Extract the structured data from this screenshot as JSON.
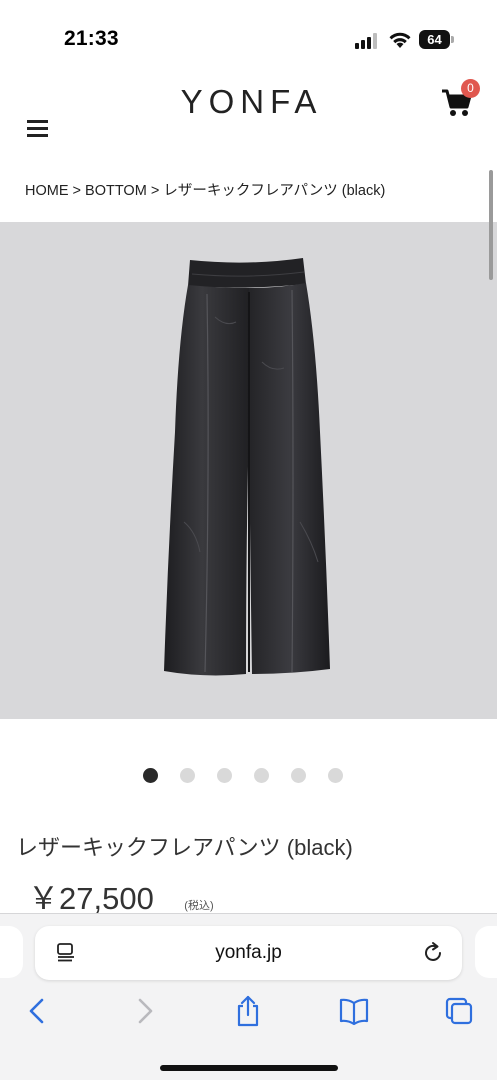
{
  "status_bar": {
    "time": "21:33",
    "battery_level": "64",
    "icons": [
      "cellular-signal-icon",
      "wifi-icon",
      "battery-icon"
    ]
  },
  "header": {
    "logo_text": "YONFA",
    "cart_count": "0",
    "icons": [
      "hamburger-menu-icon",
      "shopping-cart-icon"
    ],
    "badge_color": "#e0574f"
  },
  "breadcrumb": {
    "items": [
      "HOME",
      "BOTTOM",
      "レザーキックフレアパンツ (black)"
    ],
    "separator": ">"
  },
  "product": {
    "image_background": "#d8d8da",
    "image_description_icon": "leather-pants-image",
    "carousel": {
      "total": 6,
      "active_index": 0
    },
    "title": "レザーキックフレアパンツ (black)",
    "price": "￥27,500",
    "tax_note": "(税込)"
  },
  "browser": {
    "url": "yonfa.jp",
    "toolbar_icons": [
      "back-icon",
      "forward-icon",
      "share-icon",
      "bookmarks-icon",
      "tabs-icon"
    ],
    "accent_color": "#2f6fde",
    "disabled_color": "#b9b9bd"
  }
}
